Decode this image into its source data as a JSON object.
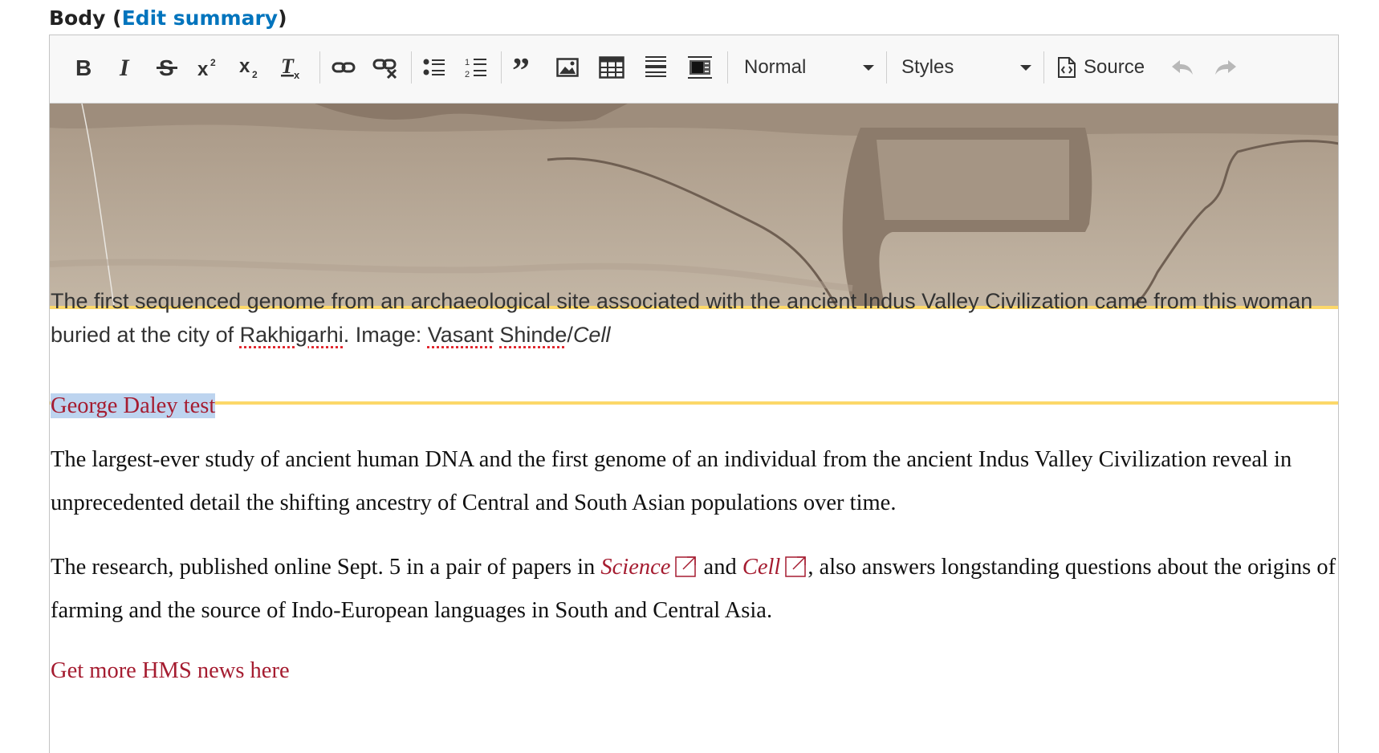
{
  "field": {
    "label": "Body",
    "open_paren": "(",
    "edit_summary_link": "Edit summary",
    "close_paren": ")"
  },
  "toolbar": {
    "buttons": [
      {
        "name": "bold-icon",
        "label": "B"
      },
      {
        "name": "italic-icon",
        "label": "I"
      },
      {
        "name": "strikethrough-icon",
        "label": "S"
      },
      {
        "name": "superscript-icon",
        "label": "x²"
      },
      {
        "name": "subscript-icon",
        "label": "x₂"
      },
      {
        "name": "remove-format-icon",
        "label": "Tx"
      },
      {
        "name": "link-icon"
      },
      {
        "name": "unlink-icon"
      },
      {
        "name": "bulleted-list-icon"
      },
      {
        "name": "numbered-list-icon"
      },
      {
        "name": "blockquote-icon"
      },
      {
        "name": "image-icon"
      },
      {
        "name": "table-icon"
      },
      {
        "name": "horizontal-rule-icon"
      },
      {
        "name": "media-embed-icon"
      },
      {
        "name": "source-icon"
      },
      {
        "name": "undo-icon"
      },
      {
        "name": "redo-icon"
      }
    ],
    "format_select": "Normal",
    "styles_select": "Styles",
    "source_label": "Source"
  },
  "caption": {
    "text_before": "The first sequenced genome from an archaeological site associated with the ancient Indus Valley Civilization came from this woman buried at the city of ",
    "place": "Rakhigarhi",
    "text_mid": ". Image: ",
    "credit_first": "Vasant",
    "credit_last": "Shinde",
    "slash": "/",
    "publication": "Cell"
  },
  "content": {
    "test_line": "George Daley test",
    "p1": "The largest-ever study of ancient human DNA and the first genome of an individual from the ancient Indus Valley Civilization reveal in unprecedented detail the shifting ancestry of Central and South Asian populations over time.",
    "p2_before": "The research, published online Sept. 5 in a pair of papers in ",
    "p2_link1": "Science",
    "p2_and": " and ",
    "p2_link2": "Cell",
    "p2_after": ", also answers longstanding questions about the origins of farming and the source of Indo-European languages in South and Central Asia.",
    "more_link": "Get more HMS news here"
  },
  "colors": {
    "link_blue": "#0074bd",
    "link_red": "#a51c30",
    "caption_border": "#fcd869",
    "selection": "#bdd4ef"
  }
}
